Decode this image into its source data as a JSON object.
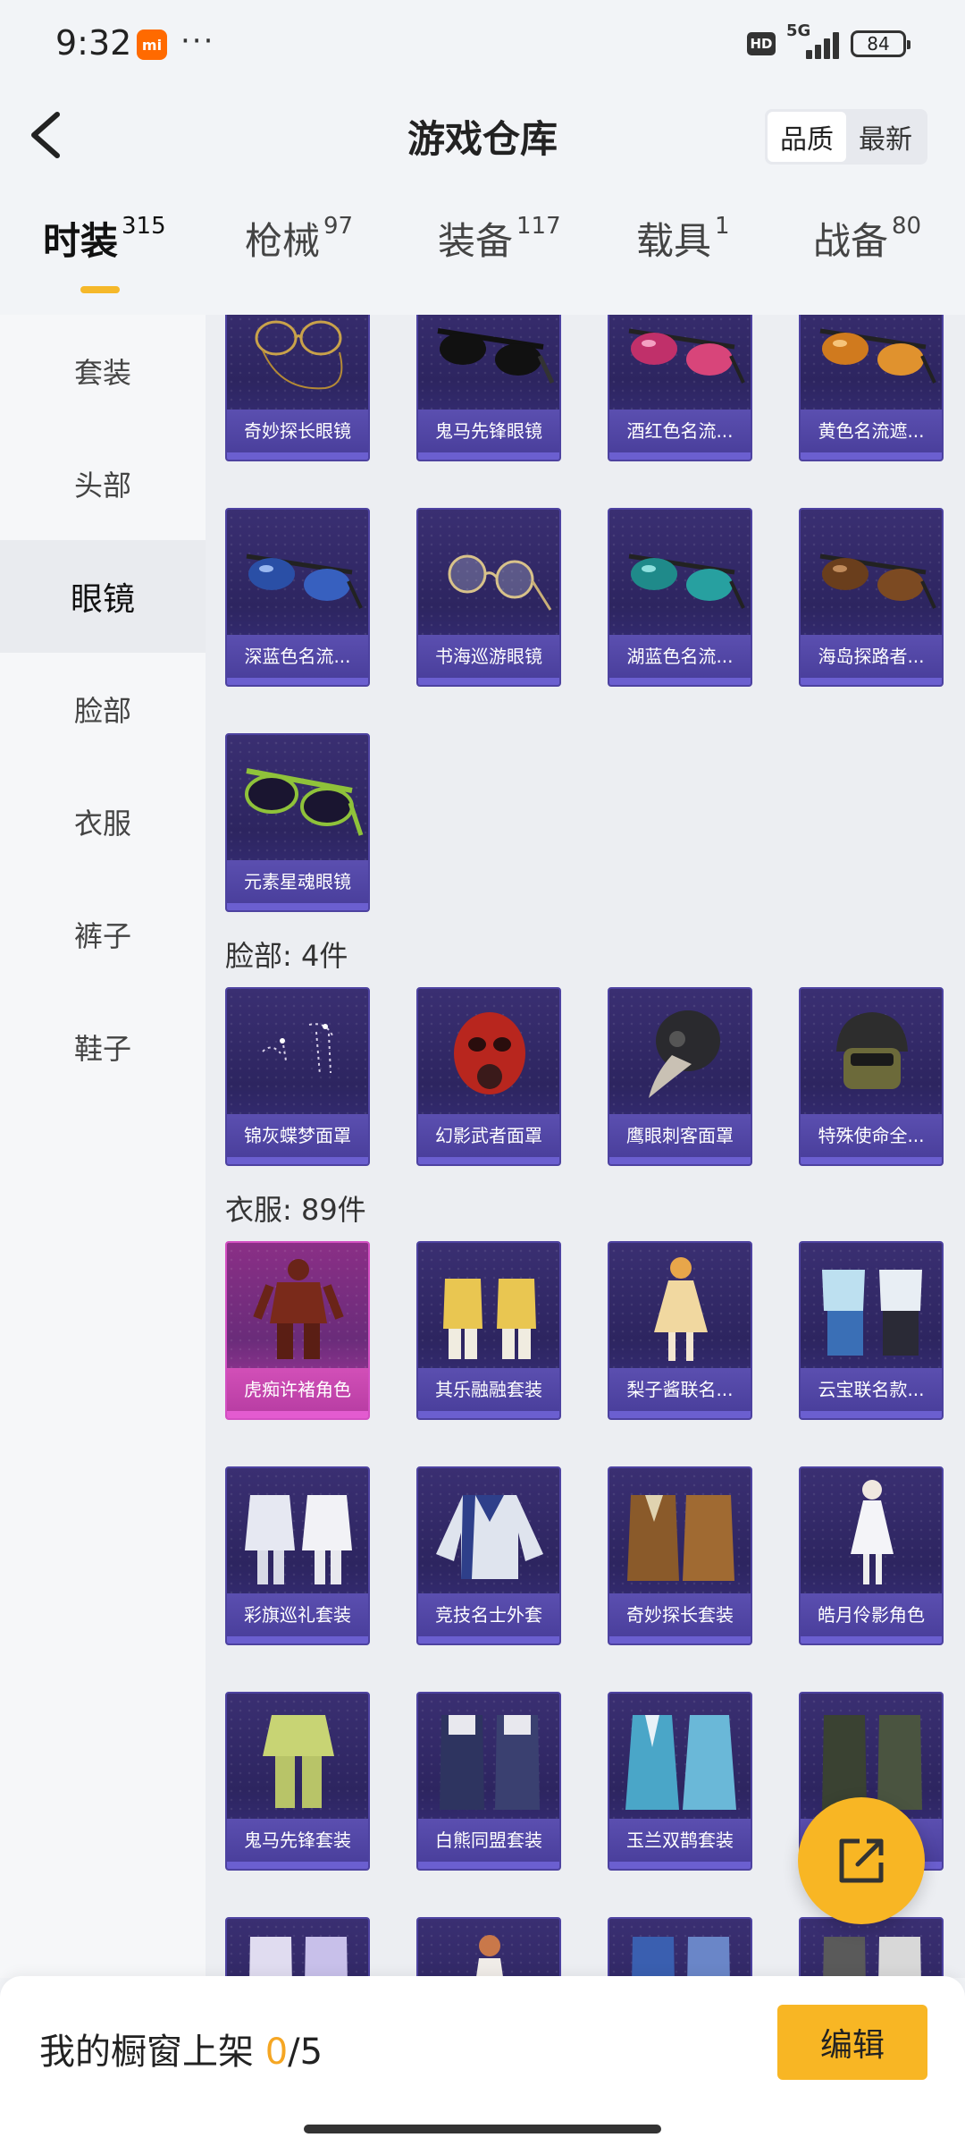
{
  "status_bar": {
    "time": "9:32",
    "app_badge": "mi",
    "more": "···",
    "hd": "HD",
    "network": "5G",
    "battery": "84"
  },
  "header": {
    "title": "游戏仓库",
    "sort_options": [
      "品质",
      "最新"
    ],
    "sort_selected": "品质"
  },
  "tabs": [
    {
      "label": "时装",
      "count": "315",
      "active": true
    },
    {
      "label": "枪械",
      "count": "97",
      "active": false
    },
    {
      "label": "装备",
      "count": "117",
      "active": false
    },
    {
      "label": "载具",
      "count": "1",
      "active": false
    },
    {
      "label": "战备",
      "count": "80",
      "active": false
    }
  ],
  "sidebar": [
    {
      "label": "套装",
      "active": false
    },
    {
      "label": "头部",
      "active": false
    },
    {
      "label": "眼镜",
      "active": true
    },
    {
      "label": "脸部",
      "active": false
    },
    {
      "label": "衣服",
      "active": false
    },
    {
      "label": "裤子",
      "active": false
    },
    {
      "label": "鞋子",
      "active": false
    }
  ],
  "sections": {
    "glasses_items": [
      {
        "name": "奇妙探长眼镜",
        "icon": "gold-chain-glasses-icon"
      },
      {
        "name": "鬼马先锋眼镜",
        "icon": "black-sunglasses-icon"
      },
      {
        "name": "酒红色名流...",
        "icon": "red-sunglasses-icon"
      },
      {
        "name": "黄色名流遮...",
        "icon": "yellow-sunglasses-icon"
      },
      {
        "name": "深蓝色名流...",
        "icon": "blue-sunglasses-icon"
      },
      {
        "name": "书海巡游眼镜",
        "icon": "round-glasses-icon"
      },
      {
        "name": "湖蓝色名流...",
        "icon": "teal-sunglasses-icon"
      },
      {
        "name": "海岛探路者...",
        "icon": "brown-sunglasses-icon"
      },
      {
        "name": "元素星魂眼镜",
        "icon": "green-sunglasses-icon"
      }
    ],
    "face": {
      "title": "脸部: 4件",
      "items": [
        {
          "name": "锦灰蝶梦面罩",
          "icon": "butterfly-mask-icon"
        },
        {
          "name": "幻影武者面罩",
          "icon": "red-gas-mask-icon"
        },
        {
          "name": "鹰眼刺客面罩",
          "icon": "plague-mask-icon"
        },
        {
          "name": "特殊使命全...",
          "icon": "tactical-helmet-icon"
        }
      ]
    },
    "clothes": {
      "title": "衣服: 89件",
      "items": [
        {
          "name": "虎痴许褚角色",
          "icon": "armor-character-icon",
          "rarity": "legendary"
        },
        {
          "name": "其乐融融套装",
          "icon": "yellow-hoodie-set-icon",
          "rarity": "epic"
        },
        {
          "name": "梨子酱联名...",
          "icon": "dress-character-icon",
          "rarity": "epic"
        },
        {
          "name": "云宝联名款...",
          "icon": "blue-outfit-set-icon",
          "rarity": "epic"
        },
        {
          "name": "彩旗巡礼套装",
          "icon": "white-dress-set-icon",
          "rarity": "epic"
        },
        {
          "name": "竞技名士外套",
          "icon": "jacket-icon",
          "rarity": "epic"
        },
        {
          "name": "奇妙探长套装",
          "icon": "trench-coat-set-icon",
          "rarity": "epic"
        },
        {
          "name": "皓月伶影角色",
          "icon": "white-dress-character-icon",
          "rarity": "epic"
        },
        {
          "name": "鬼马先锋套装",
          "icon": "green-suit-icon",
          "rarity": "epic"
        },
        {
          "name": "白熊同盟套装",
          "icon": "overalls-set-icon",
          "rarity": "epic"
        },
        {
          "name": "玉兰双鹊套装",
          "icon": "blue-robe-set-icon",
          "rarity": "epic"
        },
        {
          "name": "",
          "icon": "military-outfit-set-icon",
          "rarity": "epic"
        }
      ]
    },
    "partial_row": [
      {
        "icon": "purple-outfit-icon"
      },
      {
        "icon": "character-icon"
      },
      {
        "icon": "blue-outfit-icon"
      },
      {
        "icon": "camo-outfit-icon"
      }
    ]
  },
  "bottom_bar": {
    "label_prefix": "我的橱窗上架 ",
    "current": "0",
    "separator": "/",
    "total": "5",
    "edit_label": "编辑"
  },
  "colors": {
    "accent": "#f8b624",
    "card_epic": "#3a2f72",
    "card_legendary": "#8a2f86"
  }
}
